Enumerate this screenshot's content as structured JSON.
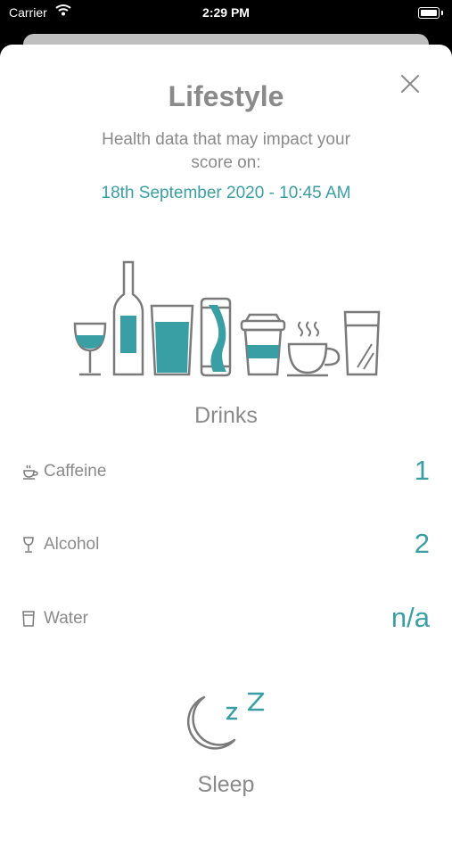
{
  "status_bar": {
    "carrier": "Carrier",
    "time": "2:29 PM"
  },
  "modal": {
    "title": "Lifestyle",
    "subtitle": "Health data that may impact your score on:",
    "date": "18th September 2020 - 10:45 AM",
    "close_icon": "close-icon"
  },
  "drinks": {
    "heading": "Drinks",
    "items": [
      {
        "label": "Caffeine",
        "value": "1",
        "icon": "coffee-cup-icon"
      },
      {
        "label": "Alcohol",
        "value": "2",
        "icon": "wine-glass-icon"
      },
      {
        "label": "Water",
        "value": "n/a",
        "icon": "water-glass-icon"
      }
    ]
  },
  "sleep": {
    "heading": "Sleep",
    "icon": "moon-zzz-icon"
  },
  "colors": {
    "accent": "#3a9ea5",
    "text_gray": "#8a8a8a",
    "line_gray": "#7a7a7a"
  }
}
